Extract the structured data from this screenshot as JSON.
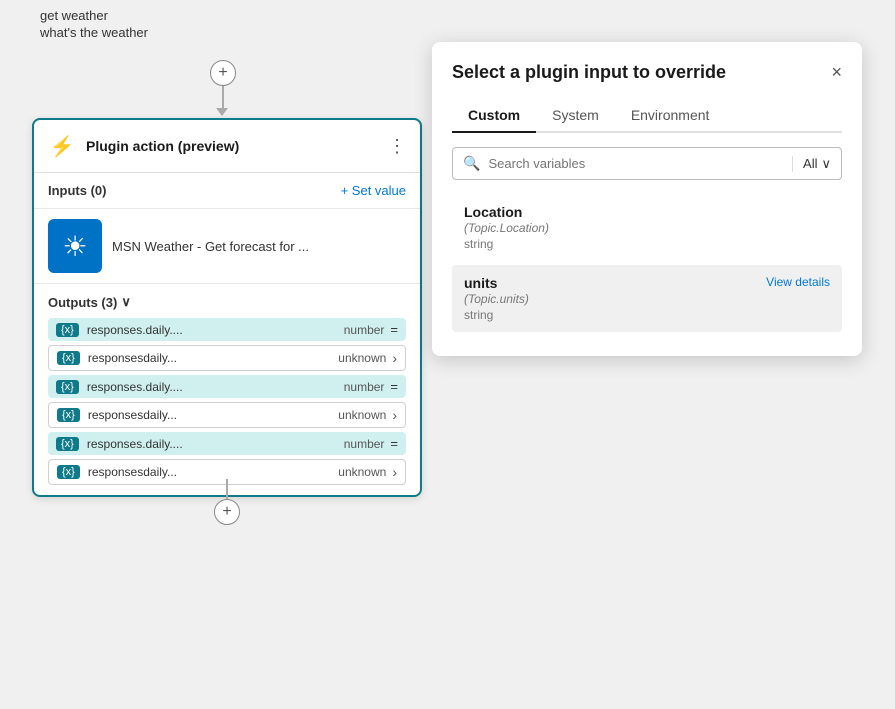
{
  "flow": {
    "trigger_lines": [
      {
        "text": "get weather"
      },
      {
        "text": "what's the weather"
      }
    ],
    "plus_symbol": "+",
    "plugin_card": {
      "icon": "⚡",
      "title": "Plugin action (preview)",
      "menu_icon": "⋮",
      "inputs_label": "Inputs (0)",
      "set_value_label": "+ Set value",
      "msn_title": "MSN Weather - Get forecast for ...",
      "msn_icon": "☀",
      "outputs_label": "Outputs (3)",
      "outputs_chevron": "∨",
      "outputs": [
        {
          "tag": "{x}",
          "name": "responses.daily....",
          "type": "number",
          "eq": "=",
          "style": "teal"
        },
        {
          "tag": "{x}",
          "name": "responsesdaily...",
          "type": "unknown",
          "arrow": "›",
          "style": "white"
        },
        {
          "tag": "{x}",
          "name": "responses.daily....",
          "type": "number",
          "eq": "=",
          "style": "teal"
        },
        {
          "tag": "{x}",
          "name": "responsesdaily...",
          "type": "unknown",
          "arrow": "›",
          "style": "white"
        },
        {
          "tag": "{x}",
          "name": "responses.daily....",
          "type": "number",
          "eq": "=",
          "style": "teal"
        },
        {
          "tag": "{x}",
          "name": "responsesdaily...",
          "type": "unknown",
          "arrow": "›",
          "style": "white"
        }
      ]
    }
  },
  "override_panel": {
    "title": "Select a plugin input to override",
    "close_icon": "×",
    "tabs": [
      {
        "label": "Custom",
        "active": true
      },
      {
        "label": "System",
        "active": false
      },
      {
        "label": "Environment",
        "active": false
      }
    ],
    "search": {
      "placeholder": "Search variables",
      "filter_label": "All",
      "chevron": "∨",
      "search_icon": "🔍"
    },
    "variables": [
      {
        "name": "Location",
        "path": "(Topic.Location)",
        "type": "string",
        "highlighted": false,
        "show_view_details": false
      },
      {
        "name": "units",
        "path": "(Topic.units)",
        "type": "string",
        "highlighted": true,
        "show_view_details": true,
        "view_details_label": "View details"
      }
    ]
  }
}
